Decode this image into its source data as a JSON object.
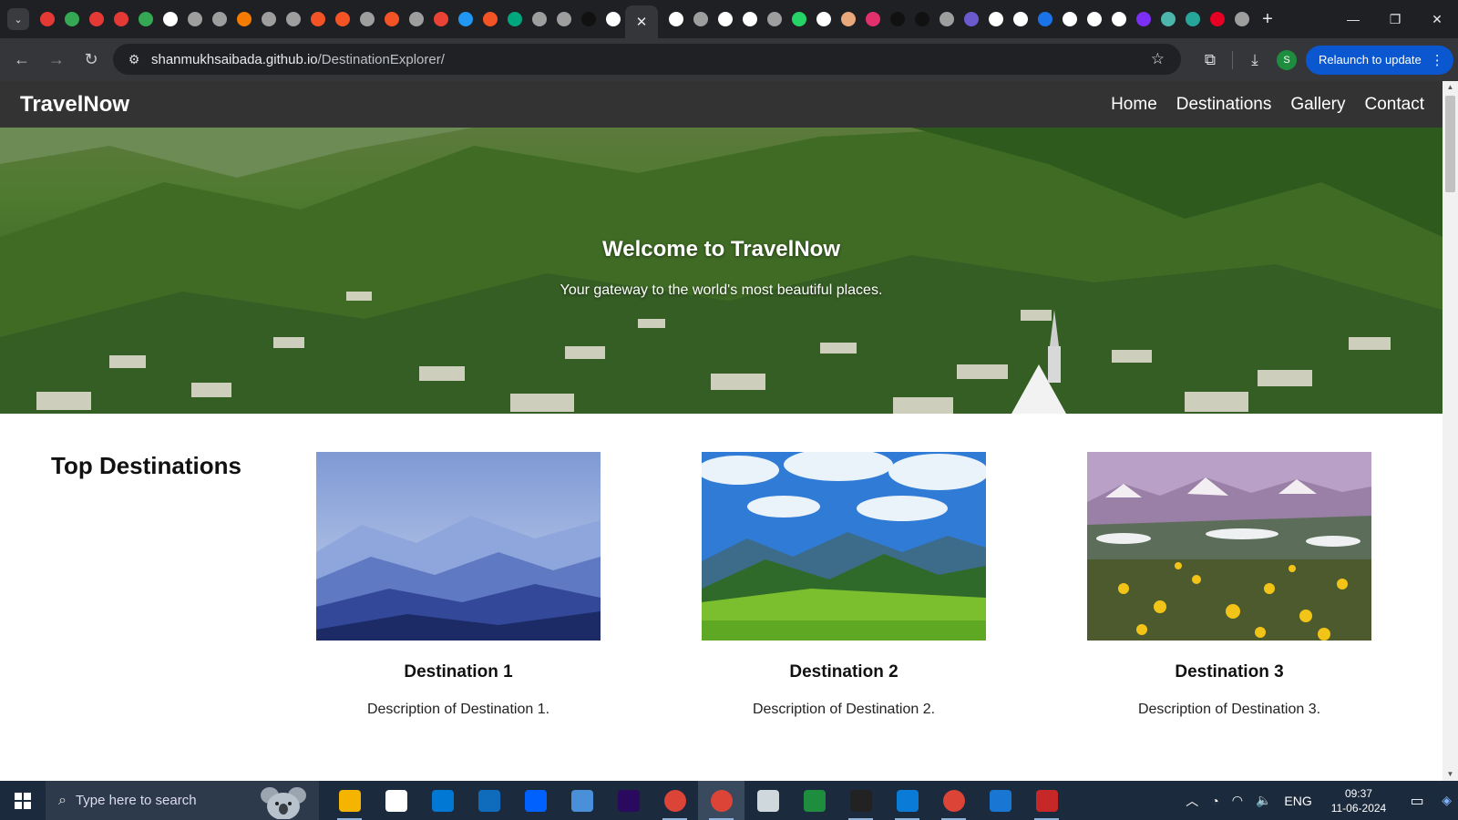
{
  "browser": {
    "active_tab_close": "✕",
    "url_host": "shanmukhsaibada.github.io",
    "url_path": "/DestinationExplorer/",
    "profile_initial": "S",
    "relaunch_label": "Relaunch to update",
    "favicon_colors": [
      "#e53935",
      "#34a853",
      "#e53935",
      "#e53935",
      "#34a853",
      "#ffffff",
      "#9e9e9e",
      "#9e9e9e",
      "#f57c00",
      "#9e9e9e",
      "#9e9e9e",
      "#f35325",
      "#f35325",
      "#9e9e9e",
      "#f35325",
      "#9e9e9e",
      "#ea4335",
      "#2196f3",
      "#f35325",
      "#00a67e",
      "#9e9e9e",
      "#9e9e9e",
      "#111111",
      "#ffffff"
    ],
    "favicon_colors_right": [
      "#ffffff",
      "#9e9e9e",
      "#ffffff",
      "#ffffff",
      "#9e9e9e",
      "#25d366",
      "#ffffff",
      "#e8a87c",
      "#e1306c",
      "#111111",
      "#111111",
      "#9e9e9e",
      "#6a5acd",
      "#ffffff",
      "#ffffff",
      "#1a73e8",
      "#ffffff",
      "#ffffff",
      "#ffffff",
      "#7b2ff7",
      "#4db6ac",
      "#26a69a",
      "#e60023",
      "#9e9e9e"
    ]
  },
  "site": {
    "brand": "TravelNow",
    "nav": [
      "Home",
      "Destinations",
      "Gallery",
      "Contact"
    ],
    "hero_title": "Welcome to TravelNow",
    "hero_subtitle": "Your gateway to the world's most beautiful places.",
    "section_title": "Top Destinations",
    "destinations": [
      {
        "title": "Destination 1",
        "description": "Description of Destination 1."
      },
      {
        "title": "Destination 2",
        "description": "Description of Destination 2."
      },
      {
        "title": "Destination 3",
        "description": "Description of Destination 3."
      }
    ]
  },
  "taskbar": {
    "search_placeholder": "Type here to search",
    "app_colors": [
      "#f4b400",
      "#ffffff",
      "#0078d4",
      "#0f6cbd",
      "#0061fe",
      "#4a90d9",
      "#2a0a5e",
      "#db4437",
      "#db4437",
      "#cfd8dc",
      "#1e8e3e",
      "#222222",
      "#0a7bd6",
      "#db4437",
      "#1976d2",
      "#c62828"
    ],
    "language": "ENG",
    "time": "09:37",
    "date": "11-06-2024"
  }
}
